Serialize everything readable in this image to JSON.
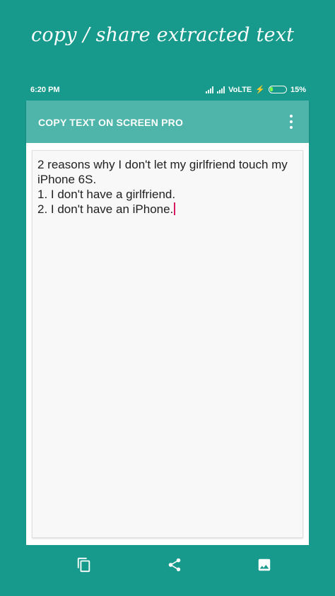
{
  "promo": {
    "title": "copy / share extracted text"
  },
  "status_bar": {
    "time": "6:20 PM",
    "network": "VoLTE",
    "battery_percent": "15%",
    "battery_level": 0.15
  },
  "app_bar": {
    "title": "COPY TEXT ON SCREEN PRO",
    "overflow_icon": "more-vert-icon"
  },
  "editor": {
    "text": "2 reasons why I don't let my girlfriend touch my iPhone 6S.\n1. I don't have a girlfriend.\n2. I don't have an iPhone."
  },
  "bottom_bar": {
    "icons": [
      "copy-icon",
      "share-icon",
      "image-icon"
    ]
  },
  "colors": {
    "background": "#179A8C",
    "app_bar": "#4FB4A9",
    "caret": "#D81B60"
  }
}
